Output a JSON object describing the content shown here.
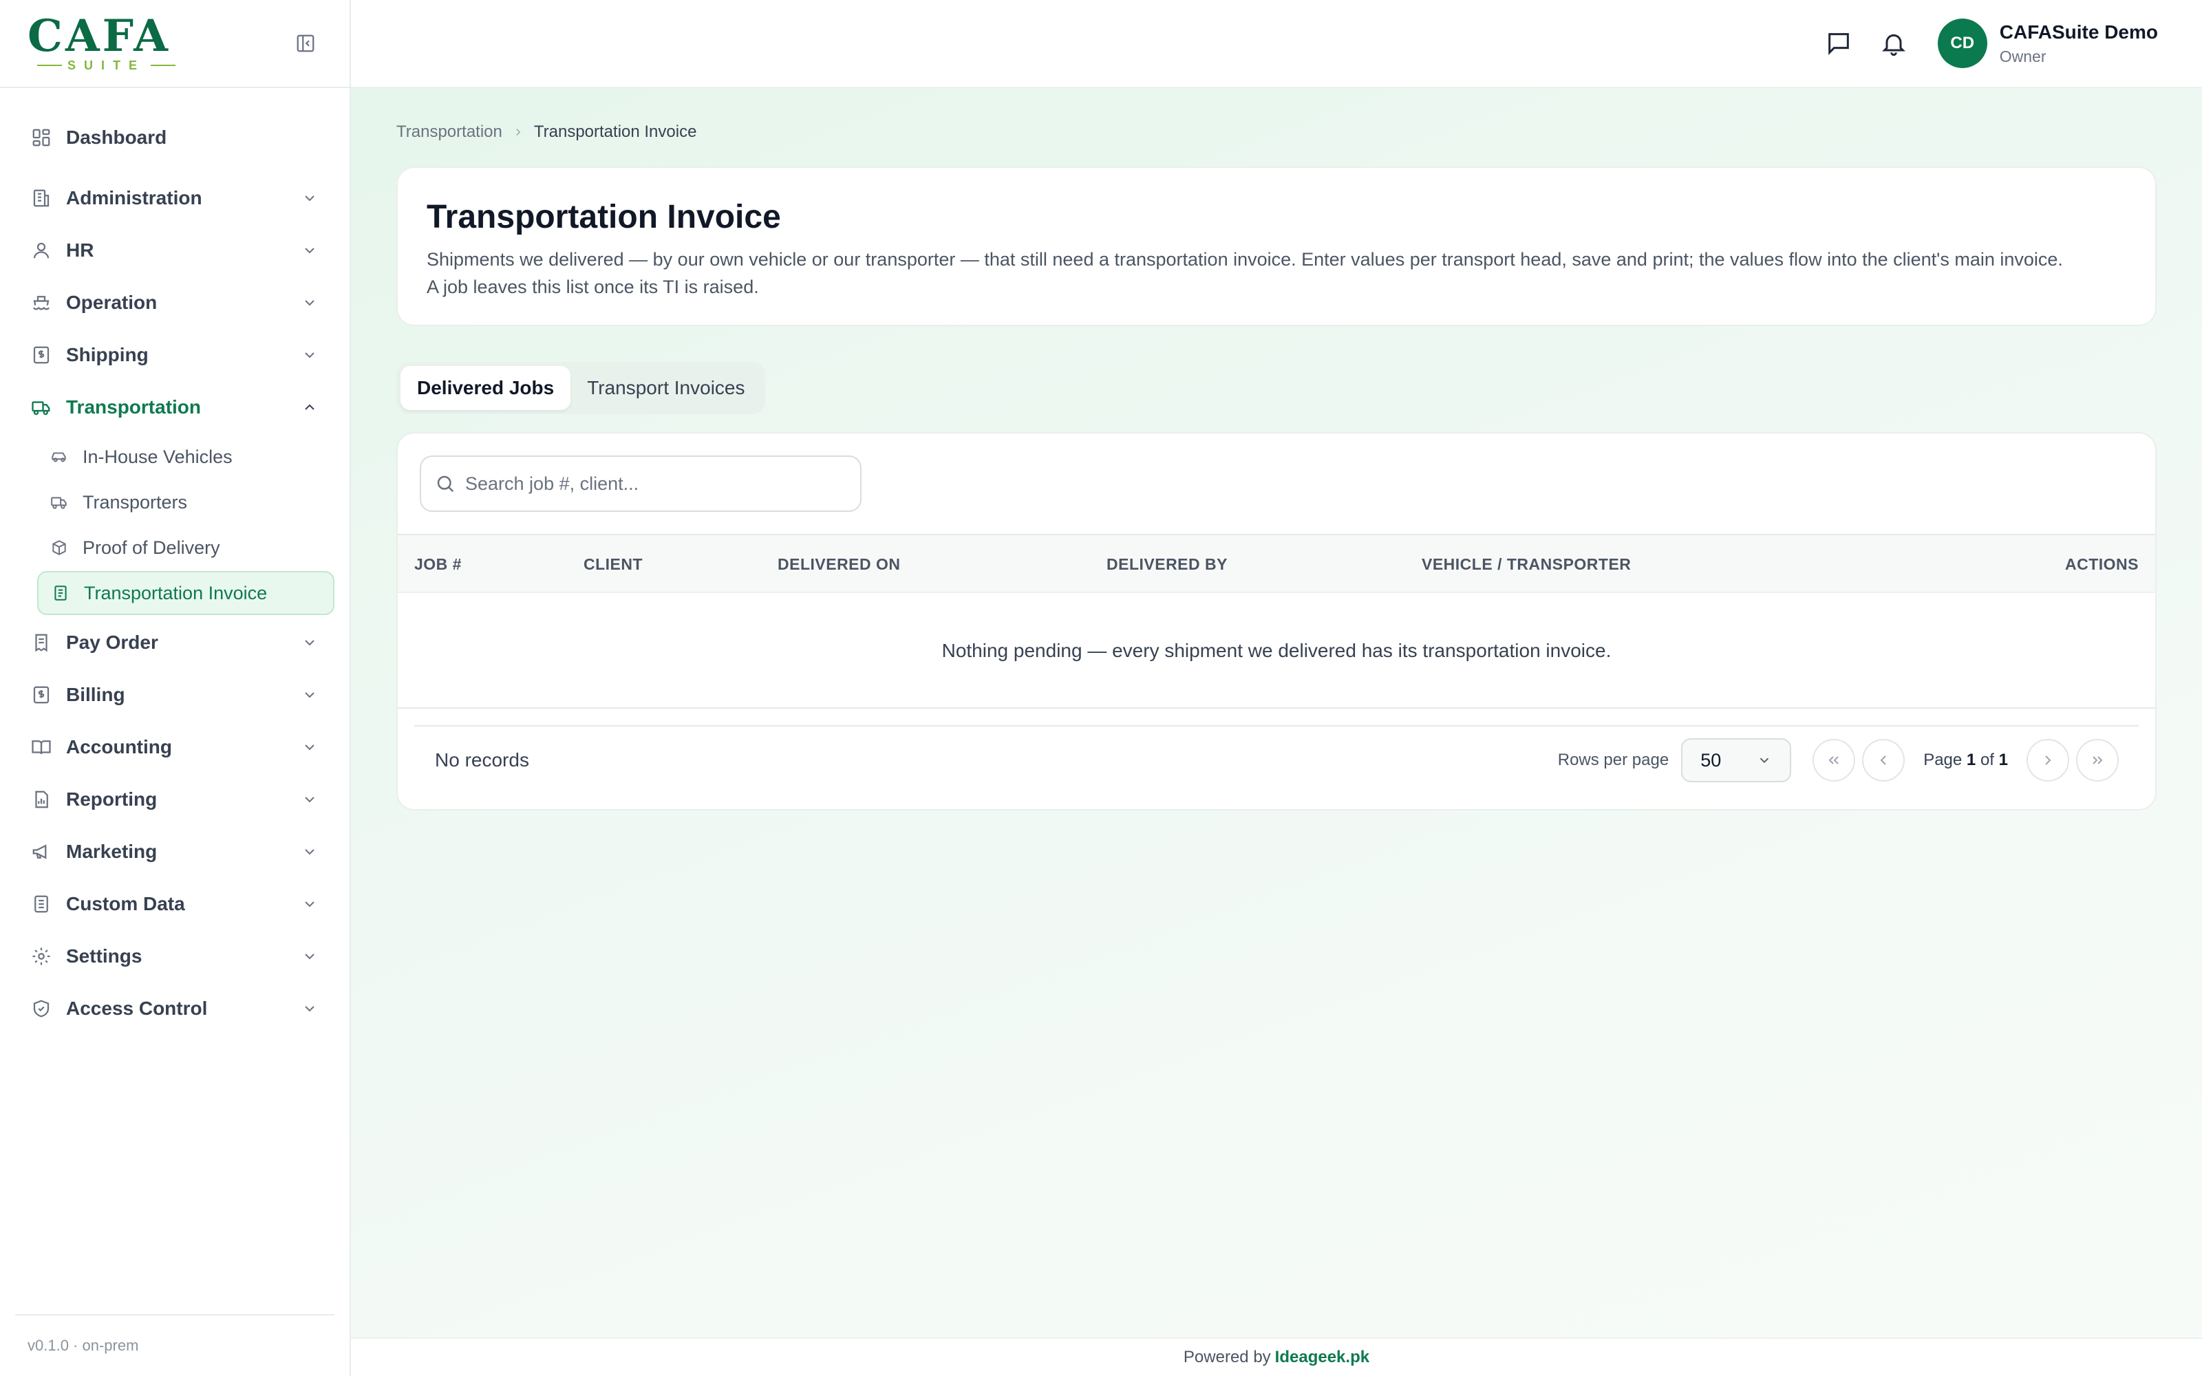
{
  "brand": {
    "logo_text": "CAFA",
    "logo_sub": "SUITE"
  },
  "sidebar": {
    "items": [
      {
        "label": "Dashboard",
        "icon": "dashboard-icon"
      },
      {
        "label": "Administration",
        "icon": "building-icon"
      },
      {
        "label": "HR",
        "icon": "user-icon"
      },
      {
        "label": "Operation",
        "icon": "ship-icon"
      },
      {
        "label": "Shipping",
        "icon": "dollar-doc-icon"
      },
      {
        "label": "Transportation",
        "icon": "truck-icon",
        "expanded": true
      },
      {
        "label": "Pay Order",
        "icon": "receipt-icon"
      },
      {
        "label": "Billing",
        "icon": "dollar-doc-icon"
      },
      {
        "label": "Accounting",
        "icon": "book-icon"
      },
      {
        "label": "Reporting",
        "icon": "report-icon"
      },
      {
        "label": "Marketing",
        "icon": "megaphone-icon"
      },
      {
        "label": "Custom Data",
        "icon": "database-icon"
      },
      {
        "label": "Settings",
        "icon": "gear-icon"
      },
      {
        "label": "Access Control",
        "icon": "shield-icon"
      }
    ],
    "sub_items": [
      {
        "label": "In-House Vehicles",
        "icon": "car-icon"
      },
      {
        "label": "Transporters",
        "icon": "truck-icon"
      },
      {
        "label": "Proof of Delivery",
        "icon": "package-icon"
      },
      {
        "label": "Transportation Invoice",
        "icon": "invoice-icon",
        "selected": true
      }
    ],
    "version": "v0.1.0 · on-prem"
  },
  "topbar": {
    "user_initials": "CD",
    "user_name": "CAFASuite Demo",
    "user_role": "Owner"
  },
  "breadcrumb": {
    "parent": "Transportation",
    "current": "Transportation Invoice"
  },
  "page": {
    "title": "Transportation Invoice",
    "description_line1": "Shipments we delivered — by our own vehicle or our transporter — that still need a transportation invoice. Enter values per transport head, save and print; the values flow into the client's main invoice.",
    "description_line2": "A job leaves this list once its TI is raised."
  },
  "tabs": [
    {
      "label": "Delivered Jobs",
      "active": true
    },
    {
      "label": "Transport Invoices",
      "active": false
    }
  ],
  "search": {
    "placeholder": "Search job #, client..."
  },
  "table": {
    "columns": [
      "JOB #",
      "CLIENT",
      "DELIVERED ON",
      "DELIVERED BY",
      "VEHICLE / TRANSPORTER",
      "ACTIONS"
    ],
    "empty_message": "Nothing pending — every shipment we delivered has its transportation invoice."
  },
  "pagination": {
    "records_text": "No records",
    "rows_per_page_label": "Rows per page",
    "rows_per_page_value": "50",
    "page_word": "Page",
    "current_page": "1",
    "of_word": "of",
    "total_pages": "1"
  },
  "footer": {
    "powered_by": "Powered by",
    "brand": "Ideageek.pk"
  },
  "colors": {
    "accent": "#0f7a4f",
    "logo_green": "#0a6b45",
    "logo_lime": "#84b83c"
  }
}
